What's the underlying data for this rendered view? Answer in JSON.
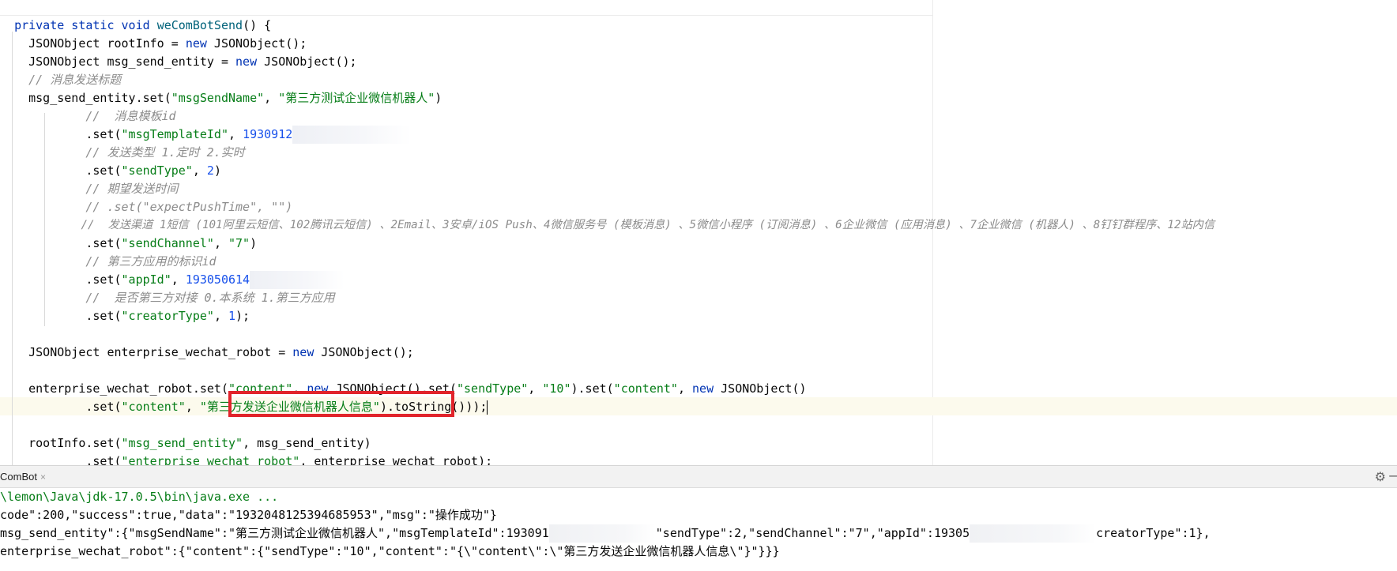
{
  "editor": {
    "line1": {
      "kw": "private static void ",
      "fn": "weComBotSend",
      "rest": "() {"
    },
    "line2": {
      "a": "    JSONObject rootInfo = ",
      "kw": "new",
      "b": " JSONObject();"
    },
    "line3": {
      "a": "    JSONObject msg_send_entity = ",
      "kw": "new",
      "b": " JSONObject();"
    },
    "line4": {
      "cmt": "    // 消息发送标题"
    },
    "line5": {
      "a": "    msg_send_entity.set(",
      "s1": "\"msgSendName\"",
      "b": ", ",
      "s2": "\"第三方测试企业微信机器人\"",
      "c": ")"
    },
    "line6": {
      "cmt": "            //  消息模板id"
    },
    "line7": {
      "a": "            .set(",
      "s1": "\"msgTemplateId\"",
      "b": ", ",
      "num": "1930912"
    },
    "line8": {
      "cmt": "            // 发送类型 1.定时 2.实时"
    },
    "line9": {
      "a": "            .set(",
      "s1": "\"sendType\"",
      "b": ", ",
      "num": "2",
      "c": ")"
    },
    "line10": {
      "cmt": "            // 期望发送时间"
    },
    "line11": {
      "cmt": "            // .set(\"expectPushTime\", \"\")"
    },
    "line12": {
      "cmt": "            //  发送渠道 1短信 (101阿里云短信、102腾讯云短信) 、2Email、3安卓/iOS Push、4微信服务号 (模板消息) 、5微信小程序 (订阅消息) 、6企业微信 (应用消息) 、7企业微信 (机器人) 、8钉钉群程序、12站内信"
    },
    "line13": {
      "a": "            .set(",
      "s1": "\"sendChannel\"",
      "b": ", ",
      "s2": "\"7\"",
      "c": ")"
    },
    "line14": {
      "cmt": "            // 第三方应用的标识id"
    },
    "line15": {
      "a": "            .set(",
      "s1": "\"appId\"",
      "b": ", ",
      "num": "193050614"
    },
    "line16": {
      "cmt": "            //  是否第三方对接 0.本系统 1.第三方应用"
    },
    "line17": {
      "a": "            .set(",
      "s1": "\"creatorType\"",
      "b": ", ",
      "num": "1",
      "c": ");"
    },
    "line19": {
      "a": "    JSONObject enterprise_wechat_robot = ",
      "kw": "new",
      "b": " JSONObject();"
    },
    "line21": {
      "a": "    enterprise_wechat_robot.set(",
      "s1": "\"content\"",
      "b": ", ",
      "kw1": "new",
      "c": " JSONObject().set(",
      "s2": "\"sendType\"",
      "d": ", ",
      "s3": "\"10\"",
      "e": ").set(",
      "s4": "\"content\"",
      "f": ", ",
      "kw2": "new",
      "g": " JSONObject()"
    },
    "line22": {
      "a": "            .set(",
      "s1": "\"content\"",
      "b": ", ",
      "s2": "\"第三方发送企业微信机器人信息\"",
      "c": ").toString()));"
    },
    "line24": {
      "a": "    rootInfo.set(",
      "s1": "\"msg_send_entity\"",
      "b": ", msg_send_entity)"
    },
    "line25": {
      "a": "            .set(",
      "s1": "\"enterprise_wechat_robot\"",
      "b": ", enterprise_wechat_robot);"
    }
  },
  "run_panel": {
    "tab_label": "ComBot",
    "tab_close": "×",
    "icons": {
      "settings": "gear-icon",
      "minimize": "minus-icon"
    },
    "lines": [
      "\\lemon\\Java\\jdk-17.0.5\\bin\\java.exe ...",
      "code\":200,\"success\":true,\"data\":\"1932048125394685953\",\"msg\":\"操作成功\"}"
    ],
    "line3": {
      "a": "msg_send_entity\":{\"msgSendName\":\"第三方测试企业微信机器人\",\"msgTemplateId\":193091",
      "b": "\"sendType\":2,\"sendChannel\":\"7\",\"appId\":19305",
      "c": "creatorType\":1},"
    },
    "line4": "enterprise_wechat_robot\":{\"content\":{\"sendType\":\"10\",\"content\":\"{\\\"content\\\":\\\"第三方发送企业微信机器人信息\\\"}\"}}}"
  },
  "colors": {
    "keyword": "#0033b3",
    "string": "#067d17",
    "number": "#1750eb",
    "comment": "#8c8c8c",
    "highlight_box": "#e1242b"
  }
}
